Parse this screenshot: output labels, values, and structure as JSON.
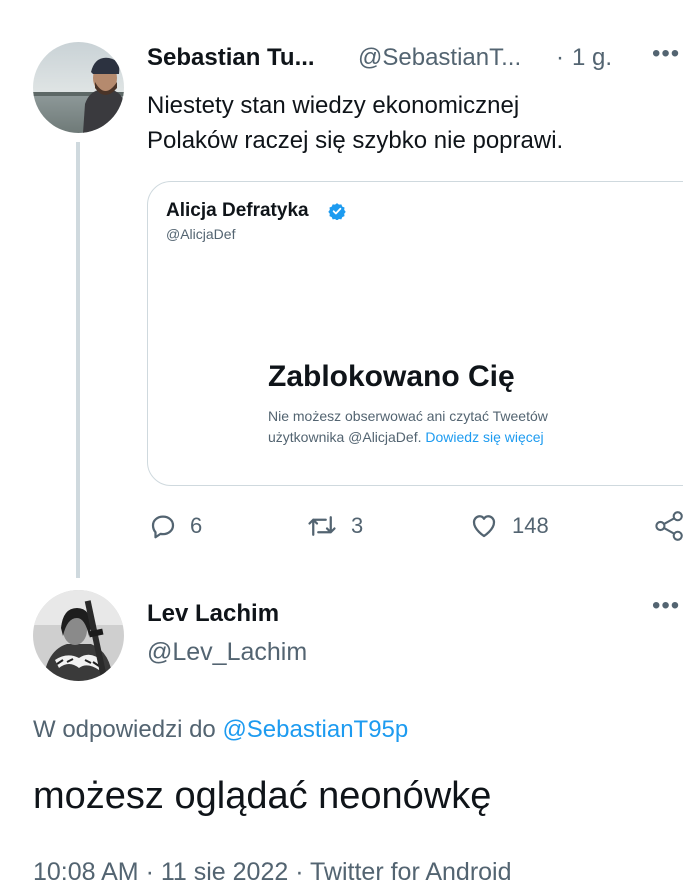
{
  "thread": {
    "tweet1": {
      "name": "Sebastian Tu...",
      "handle": "@SebastianT...",
      "separator": "·",
      "time": "1 g.",
      "more": "•••",
      "text_line1": "Niestety stan wiedzy ekonomicznej",
      "text_line2": "Polaków raczej się szybko nie poprawi.",
      "quote": {
        "name": "Alicja Defratyka",
        "handle": "@AlicjaDef",
        "blocked_title": "Zablokowano Cię",
        "blocked_desc_line1": "Nie możesz obserwować ani czytać Tweetów",
        "blocked_desc_line2": "użytkownika @AlicjaDef.",
        "learn_more": "Dowiedz się więcej"
      },
      "actions": {
        "replies": "6",
        "retweets": "3",
        "likes": "148"
      }
    },
    "tweet2": {
      "name": "Lev Lachim",
      "handle": "@Lev_Lachim",
      "more": "•••",
      "reply_to_prefix": "W odpowiedzi do",
      "reply_to_handle": "@SebastianT95p",
      "text": "możesz oglądać neonówkę",
      "meta": "10:08 AM · 11 sie 2022 · Twitter for Android"
    }
  },
  "colors": {
    "accent": "#1d9bf0",
    "text": "#0f1419",
    "secondary": "#536471",
    "border": "#cfd9de"
  }
}
